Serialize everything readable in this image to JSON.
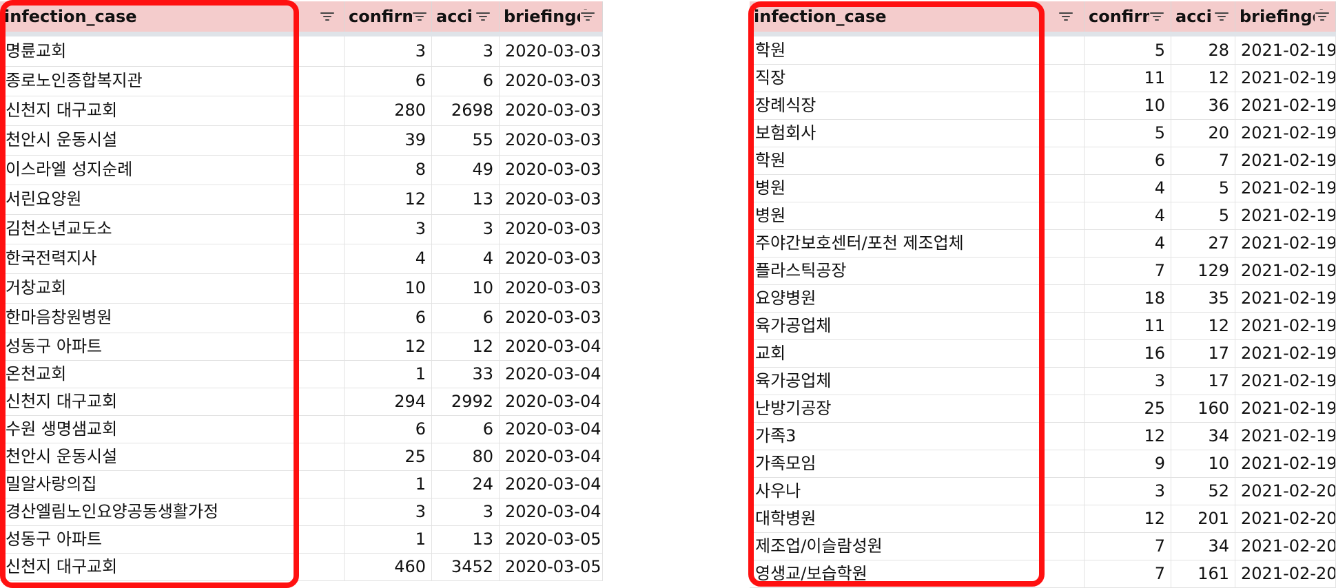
{
  "left_table": {
    "columns": [
      "infection_case",
      "confirm",
      "acci",
      "briefingd"
    ],
    "rows": [
      [
        "명륜교회",
        "3",
        "3",
        "2020-03-03"
      ],
      [
        "종로노인종합복지관",
        "6",
        "6",
        "2020-03-03"
      ],
      [
        "신천지 대구교회",
        "280",
        "2698",
        "2020-03-03"
      ],
      [
        "천안시 운동시설",
        "39",
        "55",
        "2020-03-03"
      ],
      [
        "이스라엘 성지순례",
        "8",
        "49",
        "2020-03-03"
      ],
      [
        "서린요양원",
        "12",
        "13",
        "2020-03-03"
      ],
      [
        "김천소년교도소",
        "3",
        "3",
        "2020-03-03"
      ],
      [
        "한국전력지사",
        "4",
        "4",
        "2020-03-03"
      ],
      [
        "거창교회",
        "10",
        "10",
        "2020-03-03"
      ],
      [
        "한마음창원병원",
        "6",
        "6",
        "2020-03-03"
      ],
      [
        "성동구 아파트",
        "12",
        "12",
        "2020-03-04"
      ],
      [
        "온천교회",
        "1",
        "33",
        "2020-03-04"
      ],
      [
        "신천지 대구교회",
        "294",
        "2992",
        "2020-03-04"
      ],
      [
        "수원 생명샘교회",
        "6",
        "6",
        "2020-03-04"
      ],
      [
        "천안시 운동시설",
        "25",
        "80",
        "2020-03-04"
      ],
      [
        "밀알사랑의집",
        "1",
        "24",
        "2020-03-04"
      ],
      [
        "경산엘림노인요양공동생활가정",
        "3",
        "3",
        "2020-03-04"
      ],
      [
        "성동구 아파트",
        "1",
        "13",
        "2020-03-05"
      ],
      [
        "신천지 대구교회",
        "460",
        "3452",
        "2020-03-05"
      ]
    ]
  },
  "right_table": {
    "columns": [
      "infection_case",
      "confirm",
      "acci",
      "briefingd"
    ],
    "rows": [
      [
        "학원",
        "5",
        "28",
        "2021-02-19"
      ],
      [
        "직장",
        "11",
        "12",
        "2021-02-19"
      ],
      [
        "장례식장",
        "10",
        "36",
        "2021-02-19"
      ],
      [
        "보험회사",
        "5",
        "20",
        "2021-02-19"
      ],
      [
        "학원",
        "6",
        "7",
        "2021-02-19"
      ],
      [
        "병원",
        "4",
        "5",
        "2021-02-19"
      ],
      [
        "병원",
        "4",
        "5",
        "2021-02-19"
      ],
      [
        "주야간보호센터/포천 제조업체",
        "4",
        "27",
        "2021-02-19"
      ],
      [
        "플라스틱공장",
        "7",
        "129",
        "2021-02-19"
      ],
      [
        "요양병원",
        "18",
        "35",
        "2021-02-19"
      ],
      [
        "육가공업체",
        "11",
        "12",
        "2021-02-19"
      ],
      [
        "교회",
        "16",
        "17",
        "2021-02-19"
      ],
      [
        "육가공업체",
        "3",
        "17",
        "2021-02-19"
      ],
      [
        "난방기공장",
        "25",
        "160",
        "2021-02-19"
      ],
      [
        "가족3",
        "12",
        "34",
        "2021-02-19"
      ],
      [
        "가족모임",
        "9",
        "10",
        "2021-02-19"
      ],
      [
        "사우나",
        "3",
        "52",
        "2021-02-20"
      ],
      [
        "대학병원",
        "12",
        "201",
        "2021-02-20"
      ],
      [
        "제조업/이슬람성원",
        "7",
        "34",
        "2021-02-20"
      ],
      [
        "영생교/보습학원",
        "7",
        "161",
        "2021-02-20"
      ]
    ]
  },
  "icons": {
    "filter": "filter-icon"
  },
  "colors": {
    "header_bg": "#f4cccc",
    "highlight": "#ff1010",
    "grid": "#e2e2e2"
  }
}
